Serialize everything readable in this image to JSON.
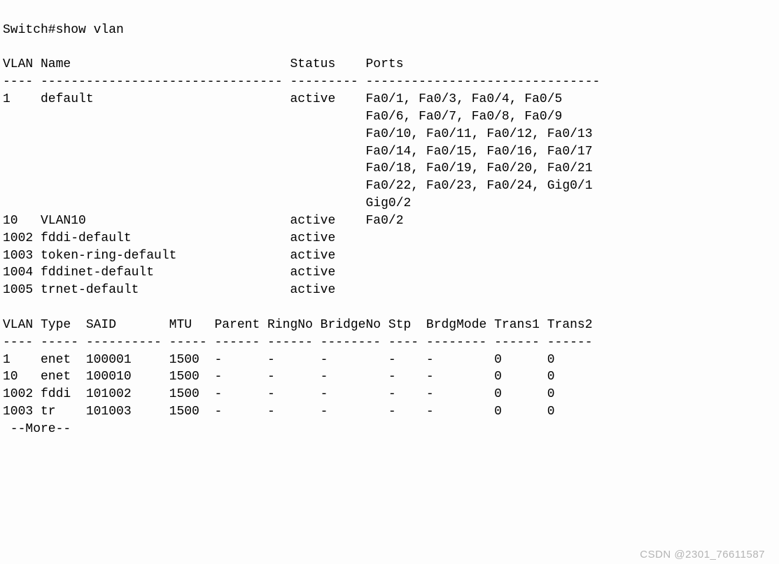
{
  "prompt": "Switch#show vlan",
  "table1": {
    "header": "VLAN Name                             Status    Ports",
    "divider": "---- -------------------------------- --------- -------------------------------",
    "rows": [
      "1    default                          active    Fa0/1, Fa0/3, Fa0/4, Fa0/5",
      "                                                Fa0/6, Fa0/7, Fa0/8, Fa0/9",
      "                                                Fa0/10, Fa0/11, Fa0/12, Fa0/13",
      "                                                Fa0/14, Fa0/15, Fa0/16, Fa0/17",
      "                                                Fa0/18, Fa0/19, Fa0/20, Fa0/21",
      "                                                Fa0/22, Fa0/23, Fa0/24, Gig0/1",
      "                                                Gig0/2",
      "10   VLAN10                           active    Fa0/2",
      "1002 fddi-default                     active    ",
      "1003 token-ring-default               active    ",
      "1004 fddinet-default                  active    ",
      "1005 trnet-default                    active    "
    ]
  },
  "table2": {
    "header": "VLAN Type  SAID       MTU   Parent RingNo BridgeNo Stp  BrdgMode Trans1 Trans2",
    "divider": "---- ----- ---------- ----- ------ ------ -------- ---- -------- ------ ------",
    "rows": [
      "1    enet  100001     1500  -      -      -        -    -        0      0",
      "10   enet  100010     1500  -      -      -        -    -        0      0",
      "1002 fddi  101002     1500  -      -      -        -    -        0      0",
      "1003 tr    101003     1500  -      -      -        -    -        0      0"
    ]
  },
  "more": " --More--",
  "watermark": "CSDN @2301_76611587"
}
